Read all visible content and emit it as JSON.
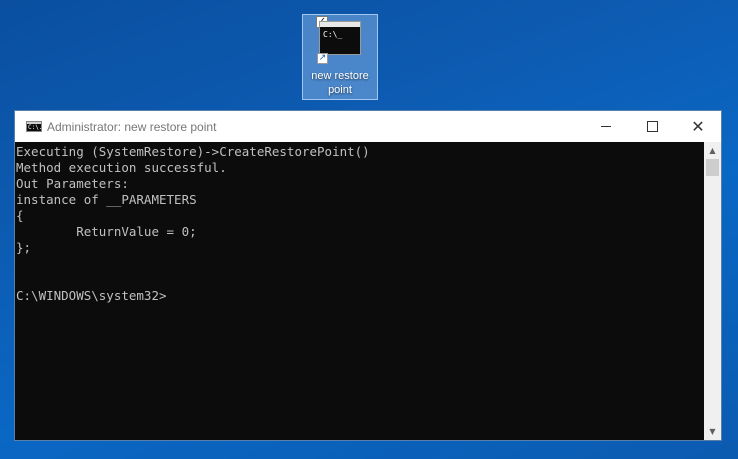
{
  "desktop": {
    "icon": {
      "label_line1": "new restore",
      "label_line2": "point",
      "image_prompt": "C:\\_",
      "icon_name": "console-shortcut-icon",
      "selected": true
    }
  },
  "window": {
    "title": "Administrator: new restore point",
    "app_icon_text": "C:\\.",
    "controls": {
      "minimize": "minimize",
      "maximize": "maximize",
      "close": "close"
    },
    "console_text": "Executing (SystemRestore)->CreateRestorePoint()\nMethod execution successful.\nOut Parameters:\ninstance of __PARAMETERS\n{\n        ReturnValue = 0;\n};\n\n\nC:\\WINDOWS\\system32>",
    "colors": {
      "console_bg": "#0c0c0c",
      "console_fg": "#c0c0c0",
      "desktop_accent": "#0b5bb0"
    }
  }
}
